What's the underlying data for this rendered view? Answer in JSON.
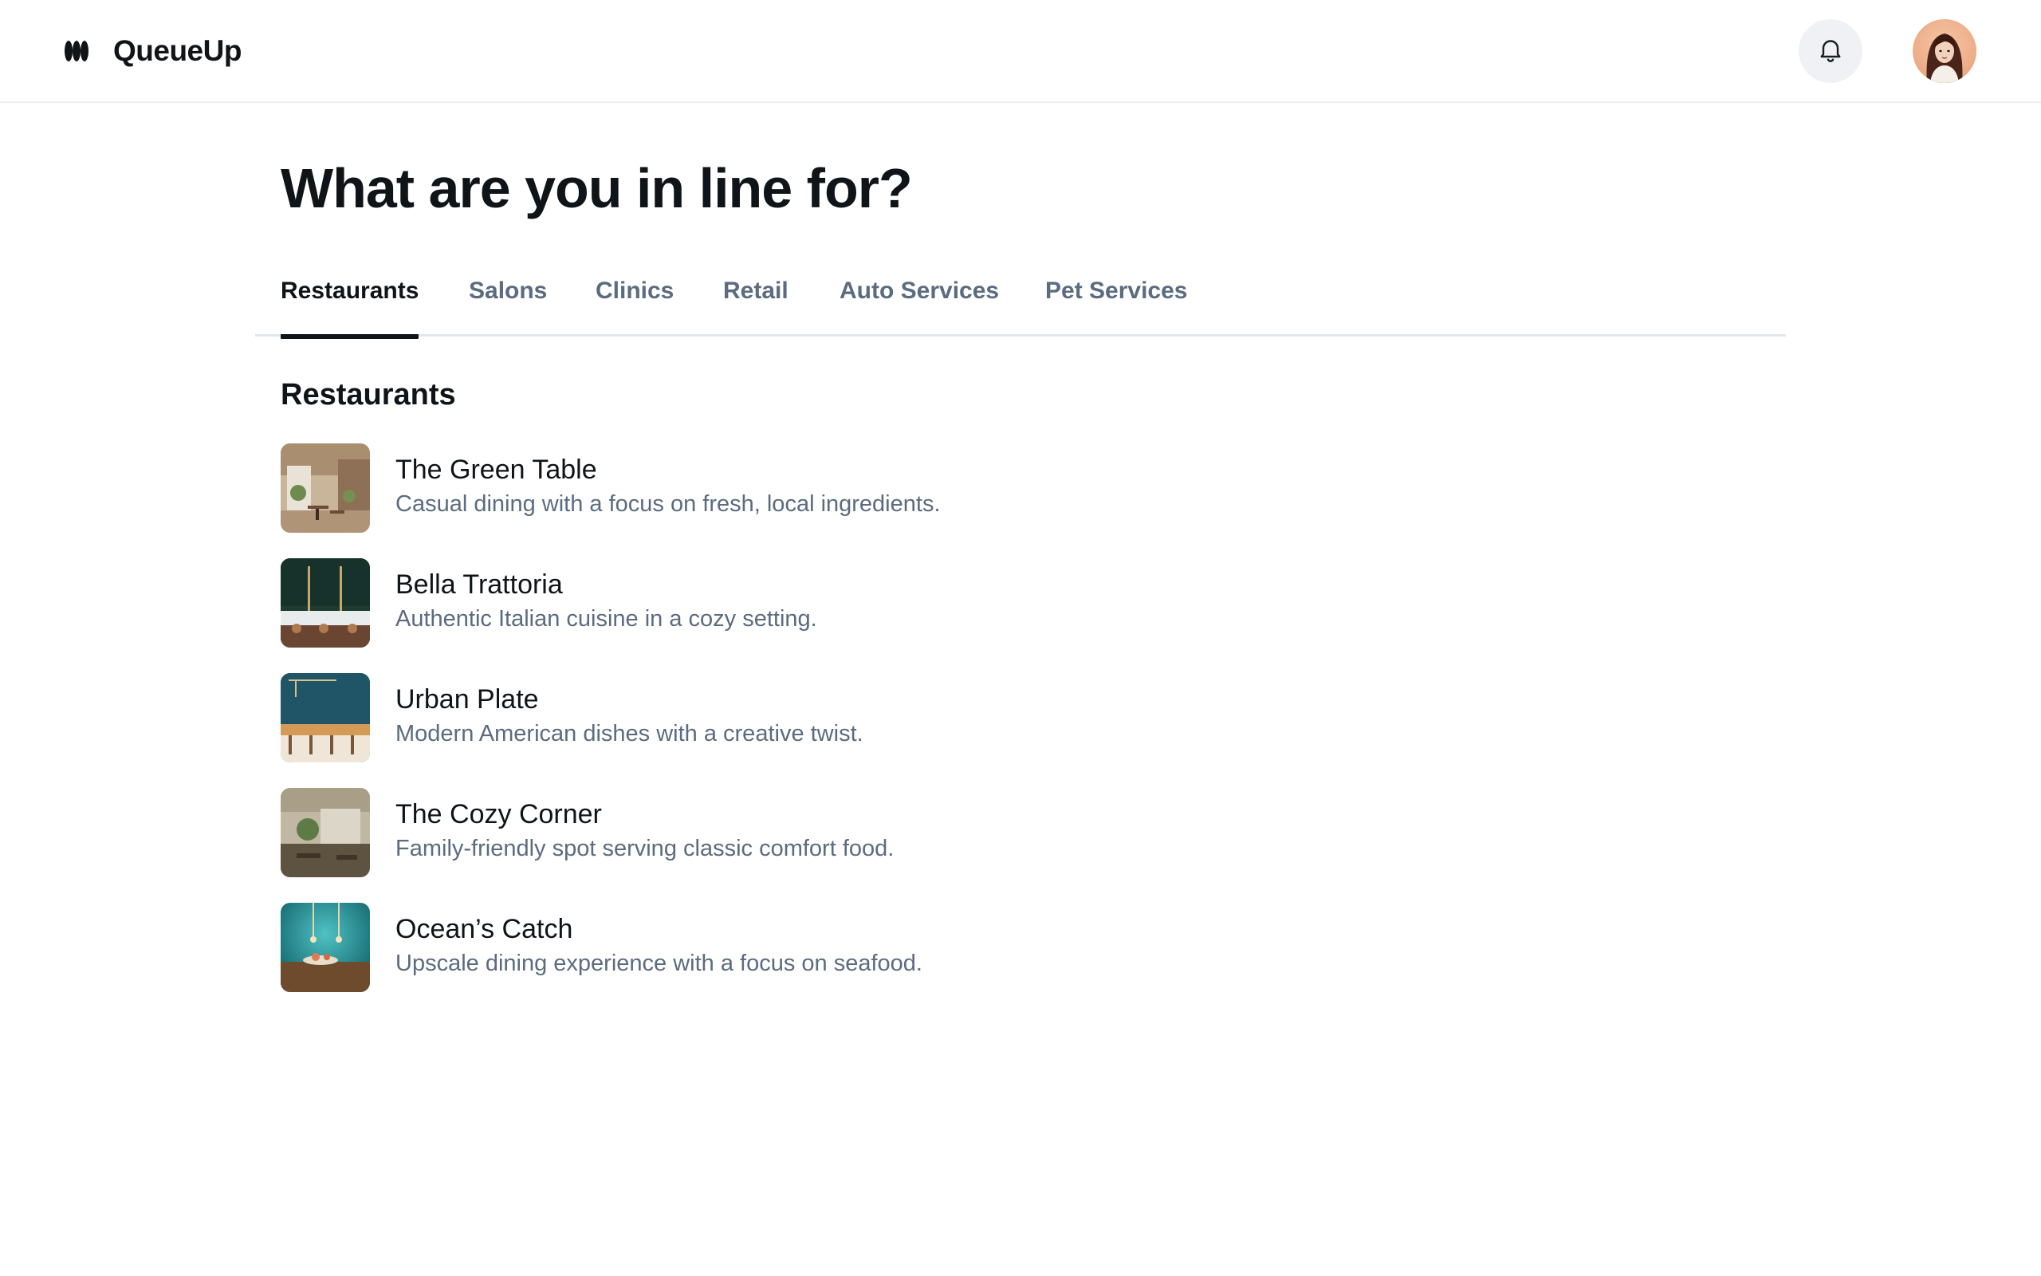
{
  "app": {
    "name": "QueueUp"
  },
  "header": {
    "notifications_icon": "bell-icon",
    "avatar_icon": "user-avatar"
  },
  "page": {
    "title": "What are you in line for?"
  },
  "tabs": [
    {
      "label": "Restaurants",
      "active": true
    },
    {
      "label": "Salons",
      "active": false
    },
    {
      "label": "Clinics",
      "active": false
    },
    {
      "label": "Retail",
      "active": false
    },
    {
      "label": "Auto Services",
      "active": false
    },
    {
      "label": "Pet Services",
      "active": false
    }
  ],
  "section": {
    "title": "Restaurants"
  },
  "restaurants": [
    {
      "name": "The Green Table",
      "description": "Casual dining with a focus on fresh, local ingredients."
    },
    {
      "name": "Bella Trattoria",
      "description": "Authentic Italian cuisine in a cozy setting."
    },
    {
      "name": "Urban Plate",
      "description": "Modern American dishes with a creative twist."
    },
    {
      "name": "The Cozy Corner",
      "description": "Family-friendly spot serving classic comfort food."
    },
    {
      "name": "Ocean’s Catch",
      "description": "Upscale dining experience with a focus on seafood."
    }
  ],
  "colors": {
    "text_primary": "#0f1419",
    "text_secondary": "#5b6b80",
    "divider": "#e3e6ea",
    "bell_bg": "#eff1f4"
  }
}
